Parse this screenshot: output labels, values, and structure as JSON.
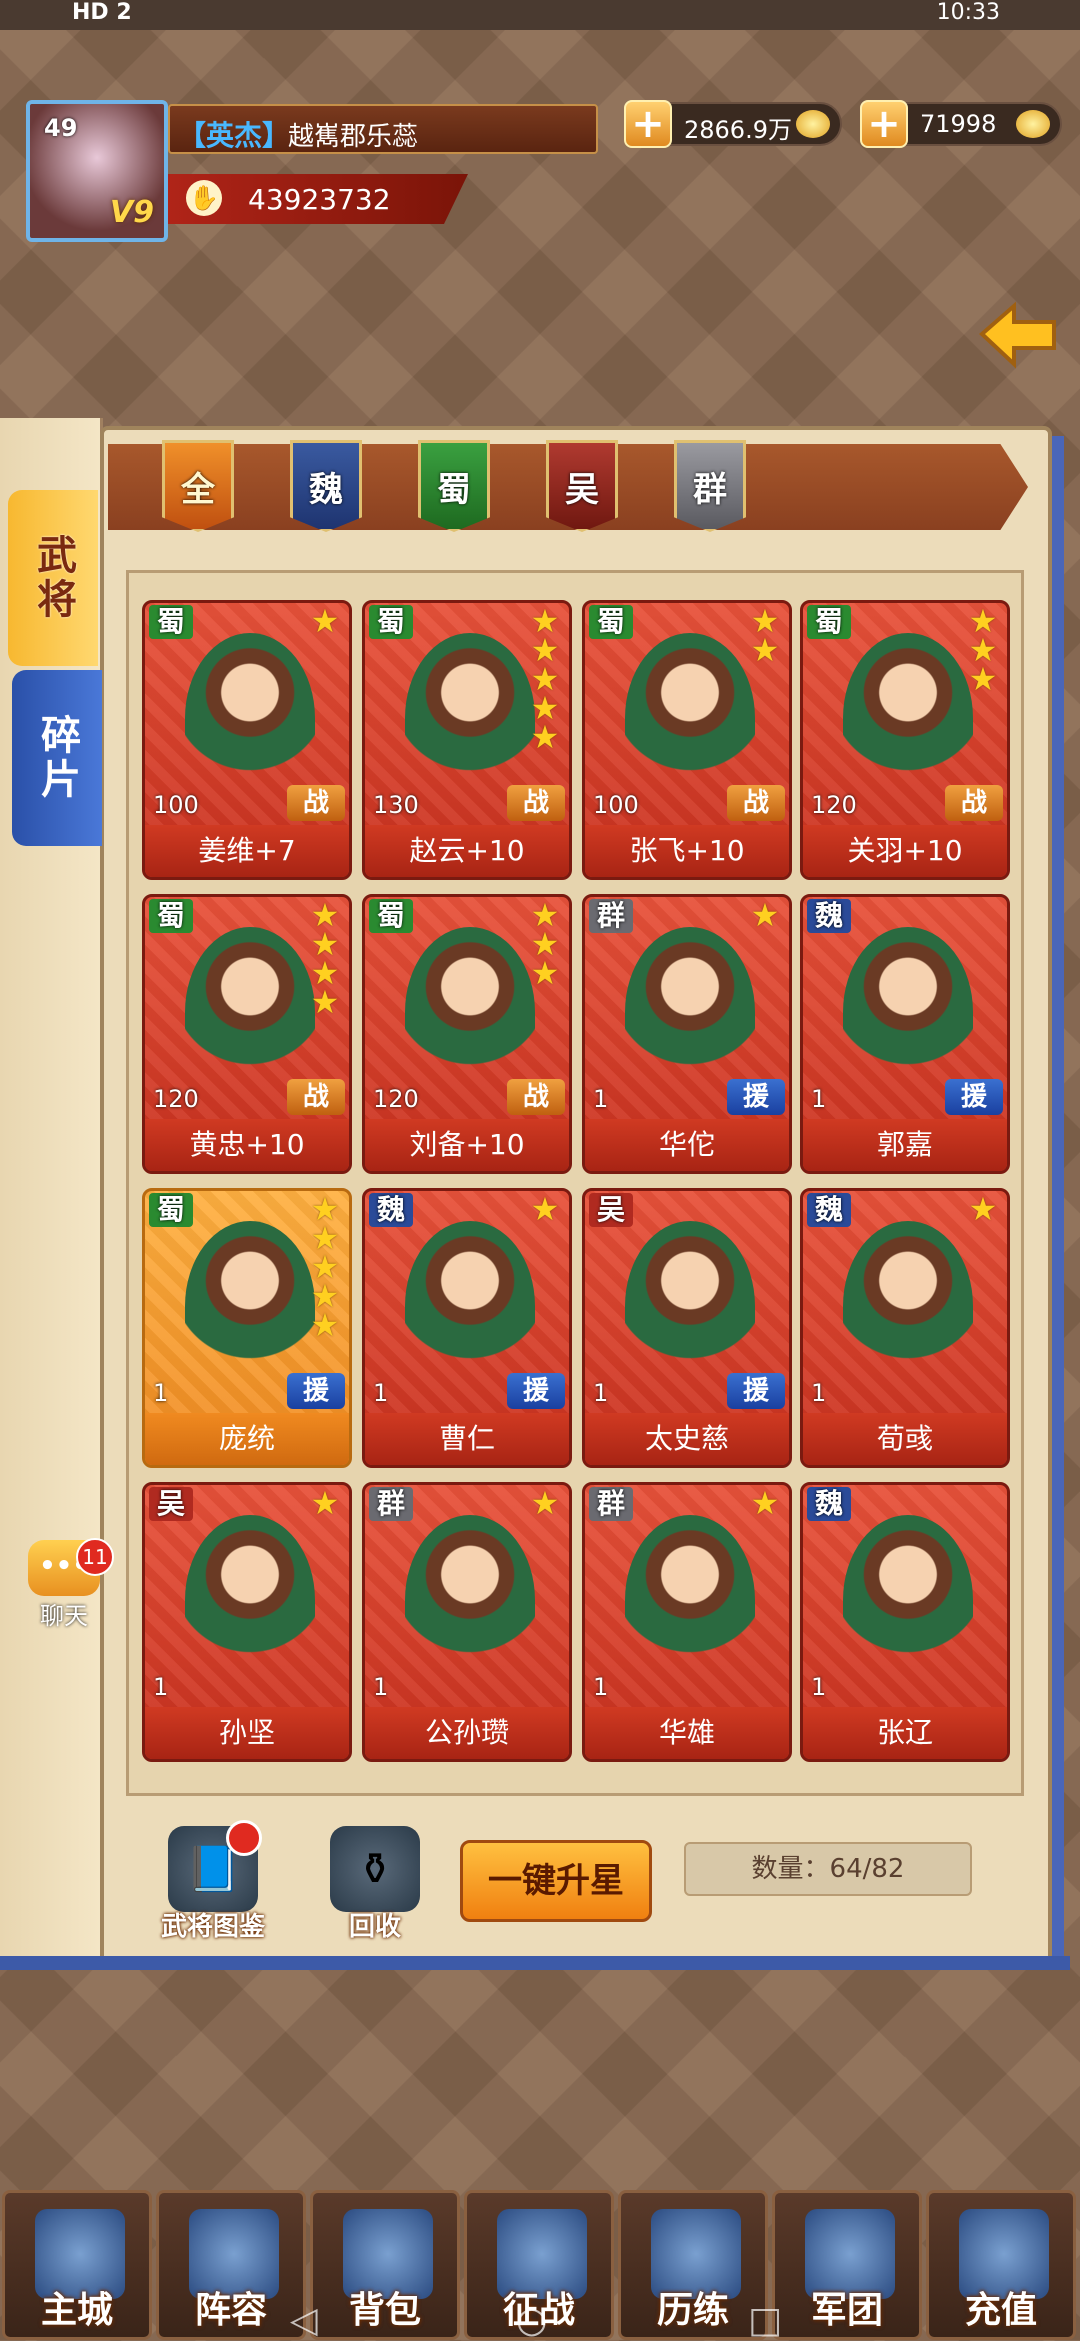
{
  "status_bar": {
    "left": "HD 2",
    "right": "10:33"
  },
  "player": {
    "level": "49",
    "vip": "V9",
    "rank": "【英杰】",
    "name": "越嶲郡乐蕊",
    "power": "43923732"
  },
  "resources": [
    {
      "value": "2866.9万"
    },
    {
      "value": "71998"
    }
  ],
  "side_tabs": {
    "generals": "武将",
    "fragments": "碎片"
  },
  "factions": [
    "全",
    "魏",
    "蜀",
    "吴",
    "群"
  ],
  "cards": [
    {
      "faction": "蜀",
      "fclass": "shu",
      "stars": 1,
      "level": "100",
      "role": "战",
      "rclass": "zhan",
      "name": "姜维+7",
      "gold": false
    },
    {
      "faction": "蜀",
      "fclass": "shu",
      "stars": 5,
      "level": "130",
      "role": "战",
      "rclass": "zhan",
      "name": "赵云+10",
      "gold": false
    },
    {
      "faction": "蜀",
      "fclass": "shu",
      "stars": 2,
      "level": "100",
      "role": "战",
      "rclass": "zhan",
      "name": "张飞+10",
      "gold": false
    },
    {
      "faction": "蜀",
      "fclass": "shu",
      "stars": 3,
      "level": "120",
      "role": "战",
      "rclass": "zhan",
      "name": "关羽+10",
      "gold": false
    },
    {
      "faction": "蜀",
      "fclass": "shu",
      "stars": 4,
      "level": "120",
      "role": "战",
      "rclass": "zhan",
      "name": "黄忠+10",
      "gold": false
    },
    {
      "faction": "蜀",
      "fclass": "shu",
      "stars": 3,
      "level": "120",
      "role": "战",
      "rclass": "zhan",
      "name": "刘备+10",
      "gold": false
    },
    {
      "faction": "群",
      "fclass": "qun",
      "stars": 1,
      "level": "1",
      "role": "援",
      "rclass": "yuan",
      "name": "华佗",
      "gold": false
    },
    {
      "faction": "魏",
      "fclass": "wei",
      "stars": 0,
      "level": "1",
      "role": "援",
      "rclass": "yuan",
      "name": "郭嘉",
      "gold": false
    },
    {
      "faction": "蜀",
      "fclass": "shu",
      "stars": 5,
      "level": "1",
      "role": "援",
      "rclass": "yuan",
      "name": "庞统",
      "gold": true
    },
    {
      "faction": "魏",
      "fclass": "wei",
      "stars": 1,
      "level": "1",
      "role": "援",
      "rclass": "yuan",
      "name": "曹仁",
      "gold": false
    },
    {
      "faction": "吴",
      "fclass": "wu",
      "stars": 0,
      "level": "1",
      "role": "援",
      "rclass": "yuan",
      "name": "太史慈",
      "gold": false
    },
    {
      "faction": "魏",
      "fclass": "wei",
      "stars": 1,
      "level": "1",
      "role": "",
      "rclass": "",
      "name": "荀彧",
      "gold": false
    },
    {
      "faction": "吴",
      "fclass": "wu",
      "stars": 1,
      "level": "1",
      "role": "",
      "rclass": "",
      "name": "孙坚",
      "gold": false
    },
    {
      "faction": "群",
      "fclass": "qun",
      "stars": 1,
      "level": "1",
      "role": "",
      "rclass": "",
      "name": "公孙瓒",
      "gold": false
    },
    {
      "faction": "群",
      "fclass": "qun",
      "stars": 1,
      "level": "1",
      "role": "",
      "rclass": "",
      "name": "华雄",
      "gold": false
    },
    {
      "faction": "魏",
      "fclass": "wei",
      "stars": 0,
      "level": "1",
      "role": "",
      "rclass": "",
      "name": "张辽",
      "gold": false
    }
  ],
  "tools": {
    "codex": "武将图鉴",
    "recycle": "回收"
  },
  "actions": {
    "upstar": "一键升星",
    "count": "数量：64/82"
  },
  "chat": {
    "label": "聊天",
    "badge": "11"
  },
  "nav": [
    "主城",
    "阵容",
    "背包",
    "征战",
    "历练",
    "军团",
    "充值"
  ]
}
